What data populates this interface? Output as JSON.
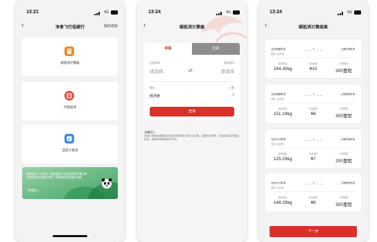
{
  "theme": {
    "accent": "#d9302a",
    "banner_green": "#3fa566",
    "background": "#f3f3f3"
  },
  "phone1": {
    "status": {
      "time": "13:21",
      "network": "5G"
    },
    "nav": {
      "title": "净享飞行低碳行",
      "right_link": "我的成就"
    },
    "menu": [
      {
        "label": "碳抵消计算器",
        "icon": "calculator-icon",
        "color": "#f08a2c"
      },
      {
        "label": "行程抵消",
        "icon": "trip-offset-icon",
        "color": "#e24b43"
      },
      {
        "label": "自定义抵消",
        "icon": "custom-offset-icon",
        "color": "#3b8fe0"
      }
    ],
    "banner": {
      "text": "低碳出行人人有责，乘坐航班产生的碳排放可通过参与碳抵消项目进行中和，共建绿色家园美好未来。",
      "link": "了解更多 >"
    }
  },
  "phone2": {
    "status": {
      "time": "13:24",
      "network": "5G"
    },
    "nav": {
      "title": "碳抵消计算器"
    },
    "tabs": [
      "单程",
      "往返"
    ],
    "from": {
      "label": "出发城市",
      "placeholder": "请选择"
    },
    "to": {
      "label": "到达城市",
      "placeholder": "请选择"
    },
    "cabin": {
      "label": "舱位",
      "value": "经济舱",
      "count_label": "人数",
      "count": "1"
    },
    "submit_label": "查询",
    "notes": {
      "title": "温馨提示",
      "text": "本碳计算器依据国际民航组织碳排放计算方法估算，结果仅供参考，实际排放量可能因机型、载客率等因素有所不同。"
    }
  },
  "phone3": {
    "status": {
      "time": "13:24",
      "network": "5G"
    },
    "nav": {
      "title": "碳抵消计算结果"
    },
    "columns": [
      "碳排放量",
      "抵消金额",
      "可得里程"
    ],
    "results": [
      {
        "from": "北京首都机场",
        "sub": "单程 | 经济舱",
        "to": "上海虹桥机场",
        "emission": "184.30kg",
        "amount": "¥10",
        "miles": "300里程"
      },
      {
        "from": "北京首都机场",
        "sub": "单程 | 经济舱",
        "to": "上海浦东机场",
        "emission": "151.19kg",
        "amount": "¥8",
        "miles": "300里程"
      },
      {
        "from": "北京大兴机场",
        "sub": "单程 | 经济舱",
        "to": "上海虹桥机场",
        "emission": "125.29kg",
        "amount": "¥7",
        "miles": "200里程"
      },
      {
        "from": "北京大兴机场",
        "sub": "单程 | 经济舱",
        "to": "上海浦东机场",
        "emission": "148.29kg",
        "amount": "¥8",
        "miles": "300里程"
      }
    ],
    "next_label": "下一步"
  }
}
